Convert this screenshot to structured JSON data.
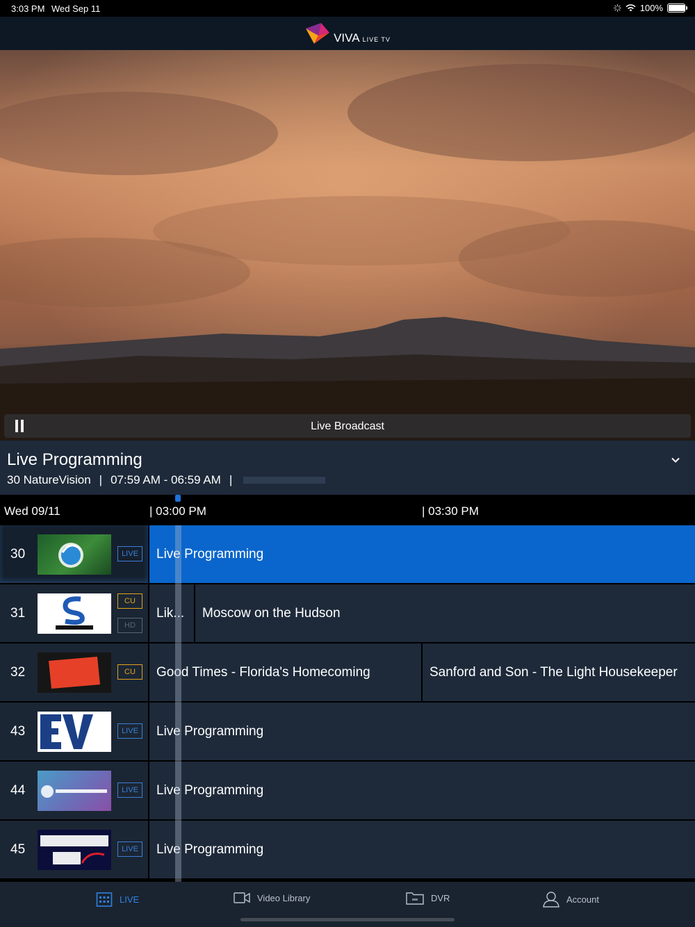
{
  "status_bar": {
    "time": "3:03 PM",
    "date": "Wed Sep 11",
    "battery": "100%",
    "battery_level": 1.0
  },
  "header": {
    "brand_main": "VIVA",
    "brand_sub": "LIVE TV"
  },
  "player": {
    "status_label": "Live Broadcast",
    "play_state": "pause-icon"
  },
  "now_playing": {
    "title": "Live Programming",
    "channel": "30 NatureVision",
    "time_range": "07:59 AM - 06:59 AM",
    "separator": "|",
    "progress_fraction": 0.0
  },
  "guide": {
    "date": "Wed 09/11",
    "time_slots": [
      "| 03:00 PM",
      "| 03:30 PM"
    ],
    "rows": [
      {
        "number": "30",
        "logo": "NV TV",
        "badges": [
          {
            "label": "LIVE",
            "kind": "live"
          }
        ],
        "programs": [
          {
            "title": "Live Programming",
            "selected": true
          }
        ]
      },
      {
        "number": "31",
        "logo": "SONY CHANNEL",
        "badges": [
          {
            "label": "CU",
            "kind": "cu"
          },
          {
            "label": "HD",
            "kind": "hd"
          }
        ],
        "programs": [
          {
            "title": "Lik..."
          },
          {
            "title": "Moscow on the Hudson"
          }
        ]
      },
      {
        "number": "32",
        "logo": "getTV",
        "badges": [
          {
            "label": "CU",
            "kind": "cu"
          }
        ],
        "programs": [
          {
            "title": "Good Times - Florida's Homecoming"
          },
          {
            "title": "Sanford and Son - The Light Housekeeper"
          }
        ]
      },
      {
        "number": "43",
        "logo": "EVtv",
        "badges": [
          {
            "label": "LIVE",
            "kind": "live"
          }
        ],
        "programs": [
          {
            "title": "Live Programming"
          }
        ]
      },
      {
        "number": "44",
        "logo": "MEDICOSTV",
        "badges": [
          {
            "label": "LIVE",
            "kind": "live"
          }
        ],
        "programs": [
          {
            "title": "Live Programming"
          }
        ]
      },
      {
        "number": "45",
        "logo": "SPORTS TV Plus",
        "badges": [
          {
            "label": "LIVE",
            "kind": "live"
          }
        ],
        "programs": [
          {
            "title": "Live Programming"
          }
        ]
      }
    ]
  },
  "tabs": [
    {
      "label": "LIVE",
      "icon": "calendar-icon",
      "active": true
    },
    {
      "label": "Video Library",
      "icon": "video-camera-icon",
      "active": false
    },
    {
      "label": "DVR",
      "icon": "folder-rec-icon",
      "active": false
    },
    {
      "label": "Account",
      "icon": "person-icon",
      "active": false
    }
  ],
  "colors": {
    "accent": "#0a66cc",
    "live_badge": "#3b7fd9",
    "cu_badge": "#e3a21a",
    "panel": "#1e2a3a"
  }
}
